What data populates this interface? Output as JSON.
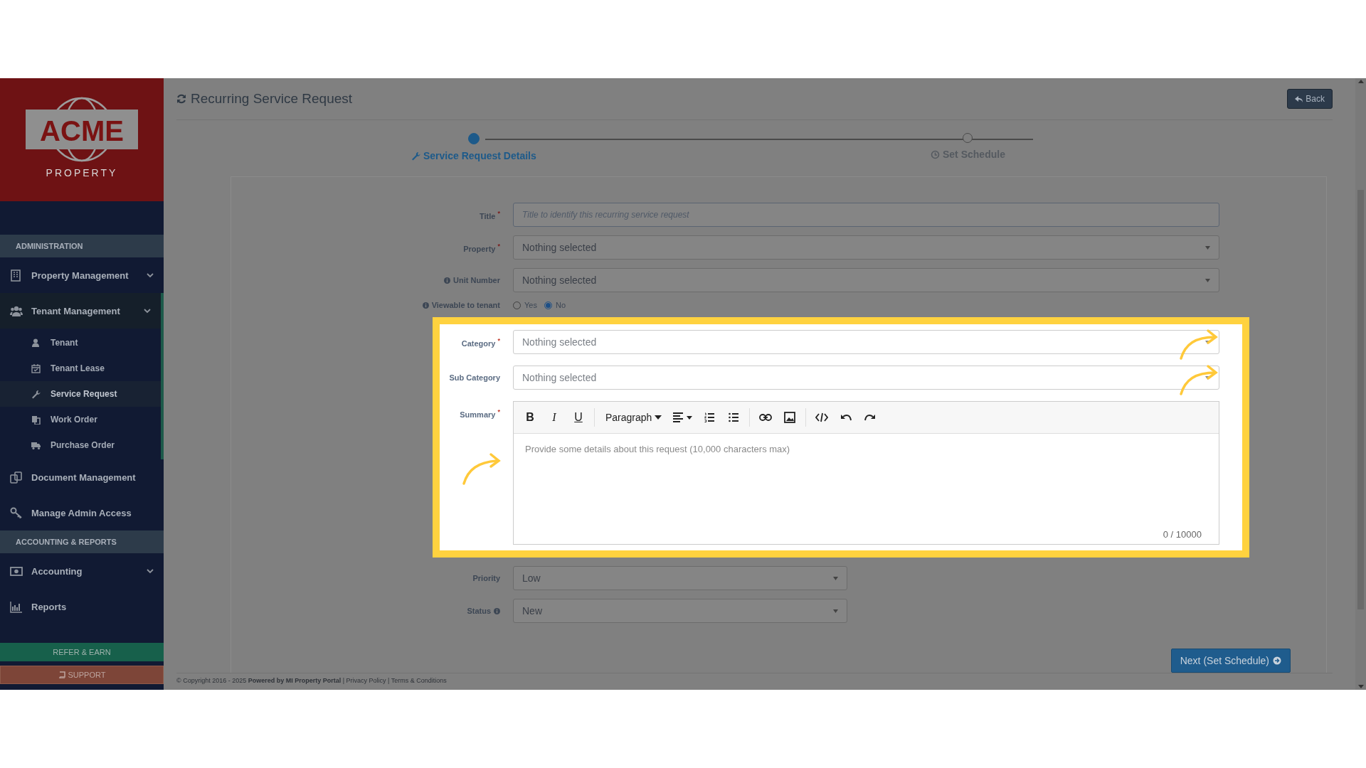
{
  "logo": {
    "name": "ACME",
    "tagline": "PROPERTY"
  },
  "sidebar": {
    "sections": [
      {
        "heading": "ADMINISTRATION",
        "items": [
          {
            "label": "Property Management",
            "expandable": true,
            "expanded": false
          },
          {
            "label": "Tenant Management",
            "expandable": true,
            "expanded": true,
            "children": [
              {
                "label": "Tenant",
                "selected": false
              },
              {
                "label": "Tenant Lease",
                "selected": false
              },
              {
                "label": "Service Request",
                "selected": true
              },
              {
                "label": "Work Order",
                "selected": false
              },
              {
                "label": "Purchase Order",
                "selected": false
              }
            ]
          },
          {
            "label": "Document Management",
            "expandable": false,
            "expanded": false
          },
          {
            "label": "Manage Admin Access",
            "expandable": false,
            "expanded": false
          }
        ]
      },
      {
        "heading": "ACCOUNTING & REPORTS",
        "items": [
          {
            "label": "Accounting",
            "expandable": true,
            "expanded": false
          },
          {
            "label": "Reports",
            "expandable": false,
            "expanded": false
          }
        ]
      }
    ],
    "buttons": [
      {
        "label": "REFER & EARN",
        "kind": "refer"
      },
      {
        "label": "SUPPORT",
        "kind": "support"
      }
    ]
  },
  "page": {
    "title": "Recurring Service Request",
    "back_button": "Back"
  },
  "stepper": [
    {
      "label": "Service Request Details",
      "selected": true
    },
    {
      "label": "Set Schedule",
      "selected": false
    }
  ],
  "form": {
    "rows": [
      {
        "kind": "text",
        "label": "Title $^{*}$",
        "placeholder": "Title to identify this recurring service request",
        "highlighted": false
      },
      {
        "kind": "select",
        "label": "Property $^{*}$",
        "value": "Nothing selected",
        "highlighted": false
      },
      {
        "kind": "select",
        "label": "Unit Number",
        "info_before": true,
        "value": "Nothing selected",
        "highlighted": false
      },
      {
        "kind": "radio",
        "label": "Viewable to tenant",
        "info_before": true,
        "options": [
          {
            "label": "Yes",
            "selected": false
          },
          {
            "label": "No",
            "selected": true
          }
        ],
        "highlighted": false
      },
      {
        "kind": "select",
        "label": "Category $^{*}$",
        "value": "Nothing selected",
        "highlighted": true,
        "pointer_right": true
      },
      {
        "kind": "select",
        "label": "Sub Category",
        "value": "Nothing selected",
        "highlighted": true,
        "pointer_right": true
      },
      {
        "kind": "editor",
        "label": "Summary $^{*}$",
        "toolbar": [
          {
            "kind": "bold",
            "text": "B"
          },
          {
            "kind": "italic",
            "text": "I"
          },
          {
            "kind": "underline",
            "text": "U"
          },
          {
            "kind": "sep"
          },
          {
            "kind": "dropdown",
            "text": "Paragraph"
          },
          {
            "kind": "align"
          },
          {
            "kind": "ol"
          },
          {
            "kind": "ul"
          },
          {
            "kind": "sep"
          },
          {
            "kind": "link"
          },
          {
            "kind": "image"
          },
          {
            "kind": "sep"
          },
          {
            "kind": "code"
          },
          {
            "kind": "undo"
          },
          {
            "kind": "redo"
          }
        ],
        "placeholder": "Provide some details about this request (10,000 characters max)",
        "counter": "0 / 10000",
        "highlighted": true,
        "pointer_left": true
      },
      {
        "kind": "select",
        "label": "Priority",
        "value": "Low",
        "highlighted": false,
        "narrow": true
      },
      {
        "kind": "select",
        "label": "Status",
        "info_after": true,
        "value": "New",
        "highlighted": false,
        "narrow": true
      }
    ],
    "next_button": "Next (Set Schedule)"
  },
  "footer": "© Copyright 2016 - 2025 **Powered by MI Property Portal** | Privacy Policy | Terms & Conditions"
}
